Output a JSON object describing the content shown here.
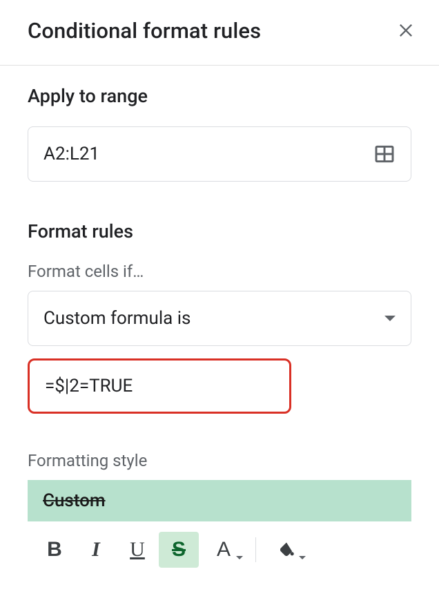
{
  "header": {
    "title": "Conditional format rules"
  },
  "range": {
    "heading": "Apply to range",
    "value": "A2:L21"
  },
  "rules": {
    "heading": "Format rules",
    "condition_label": "Format cells if…",
    "condition_selected": "Custom formula is",
    "formula_value": "=$|2=TRUE"
  },
  "style": {
    "label": "Formatting style",
    "preview_text": "Custom"
  },
  "toolbar": {
    "bold": "B",
    "italic": "I",
    "underline": "U",
    "strike": "S",
    "textcolor": "A"
  }
}
